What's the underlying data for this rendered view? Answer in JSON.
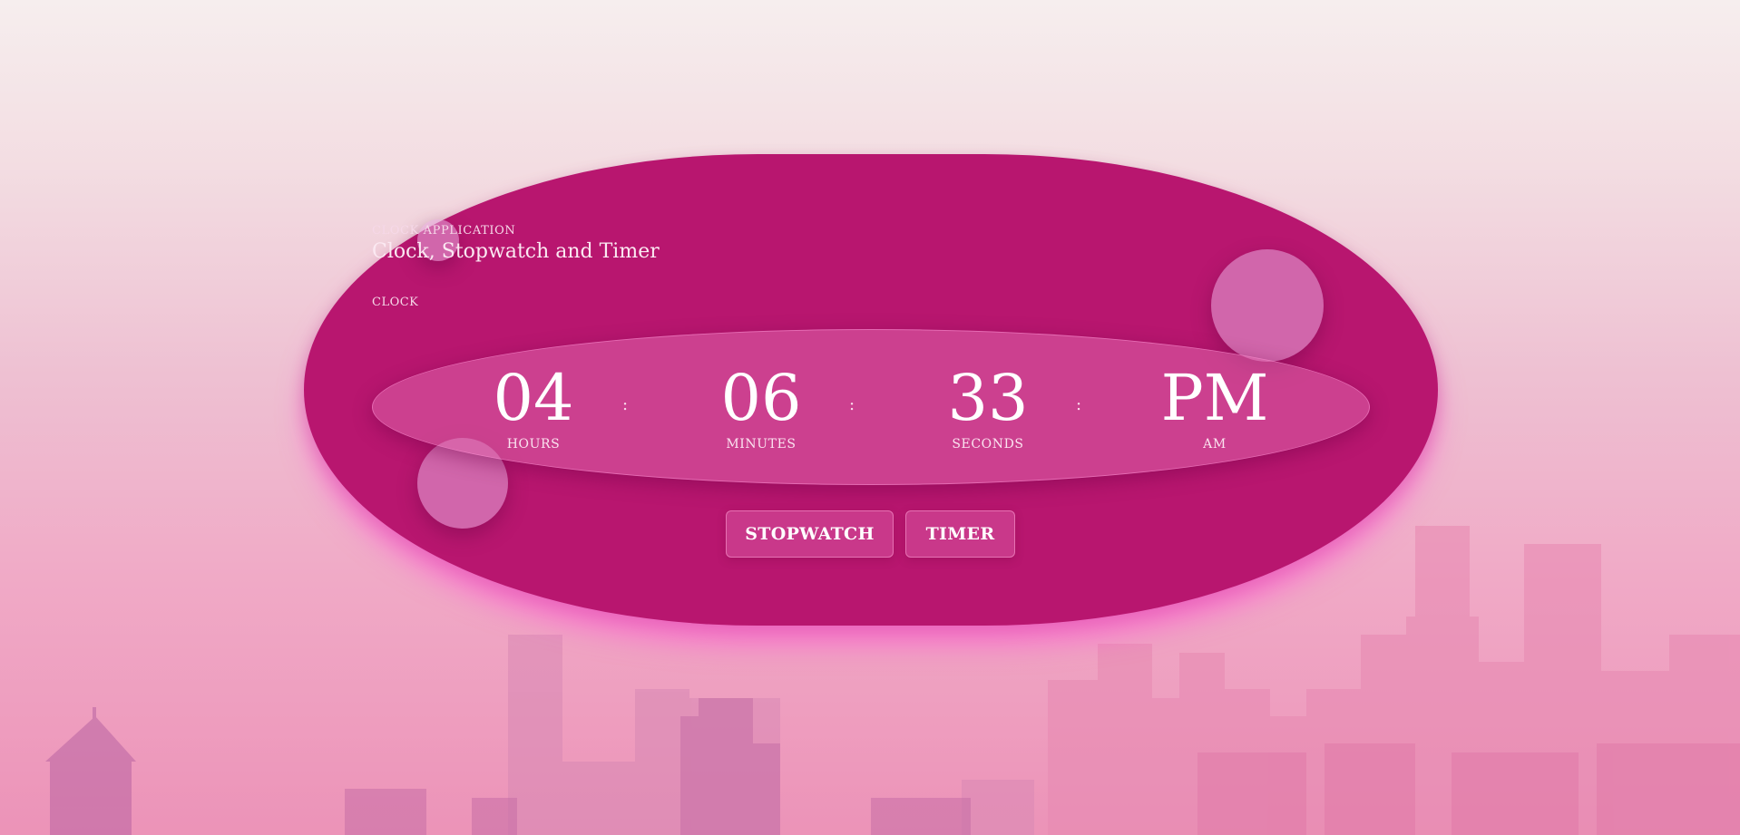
{
  "app": {
    "eyebrow": "CLOCK APPLICATION",
    "title": "Clock, Stopwatch and Timer",
    "section": "CLOCK"
  },
  "clock": {
    "hours": {
      "value": "04",
      "label": "HOURS"
    },
    "minutes": {
      "value": "06",
      "label": "MINUTES"
    },
    "seconds": {
      "value": "33",
      "label": "SECONDS"
    },
    "period": {
      "value": "PM",
      "label": "AM"
    },
    "separator": ":"
  },
  "buttons": {
    "stopwatch": "STOPWATCH",
    "timer": "TIMER"
  },
  "colors": {
    "card": "#b8166f",
    "panel": "#d964a9",
    "text": "#ffffff",
    "glow": "#ff50d2"
  }
}
